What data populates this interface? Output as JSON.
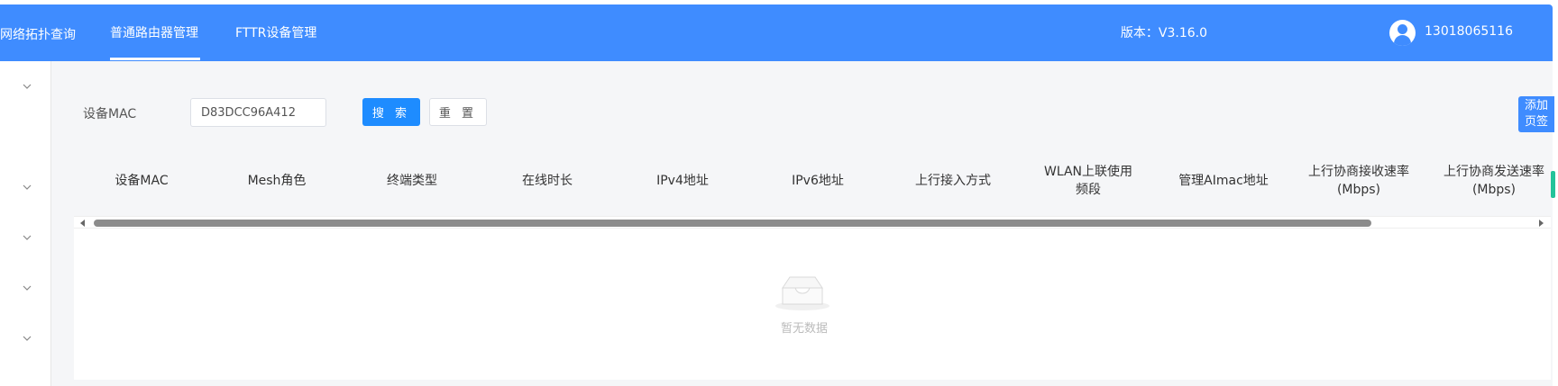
{
  "header": {
    "nav": [
      {
        "label": "网络拓扑查询"
      },
      {
        "label": "普通路由器管理"
      },
      {
        "label": "FTTR设备管理"
      }
    ],
    "version": "版本：V3.16.0",
    "user": "13018065116",
    "bg_color": "#3f8cff"
  },
  "search": {
    "label": "设备MAC",
    "value": "D83DCC96A412",
    "search_button": "搜 索",
    "reset_button": "重 置"
  },
  "add_tab": {
    "line1": "添加",
    "line2": "页签"
  },
  "table": {
    "columns": [
      {
        "label": "设备MAC"
      },
      {
        "label": "Mesh角色"
      },
      {
        "label": "终端类型"
      },
      {
        "label": "在线时长"
      },
      {
        "label": "IPv4地址"
      },
      {
        "label": "IPv6地址"
      },
      {
        "label": "上行接入方式"
      },
      {
        "label": "WLAN上联使用频段"
      },
      {
        "label": "管理AImac地址"
      },
      {
        "label": "上行协商接收速率(Mbps)"
      },
      {
        "label": "上行协商发送速率(Mbps)"
      }
    ],
    "empty_text": "暂无数据"
  },
  "icons": {
    "sidebar": "chevron-down-icon",
    "avatar": "user-avatar-icon",
    "empty": "empty-inbox-icon"
  }
}
